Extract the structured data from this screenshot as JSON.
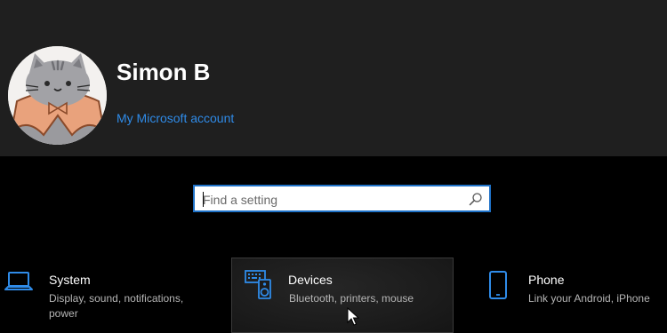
{
  "profile": {
    "name": "Simon B",
    "account_link": "My Microsoft account",
    "avatar_icon": "pusheen-cat-avatar"
  },
  "search": {
    "placeholder": "Find a setting",
    "value": "",
    "icon": "search-icon"
  },
  "categories": [
    {
      "title": "System",
      "description": "Display, sound, notifications, power",
      "icon": "laptop-icon"
    },
    {
      "title": "Devices",
      "description": "Bluetooth, printers, mouse",
      "icon": "keyboard-speaker-icon",
      "hovered": true
    },
    {
      "title": "Phone",
      "description": "Link your Android, iPhone",
      "icon": "phone-icon"
    }
  ],
  "colors": {
    "accent": "#2f8be8",
    "header_bg": "#1f1f1f",
    "page_bg": "#000000",
    "search_border": "#1f72c8",
    "description_text": "#b5b5b5"
  }
}
